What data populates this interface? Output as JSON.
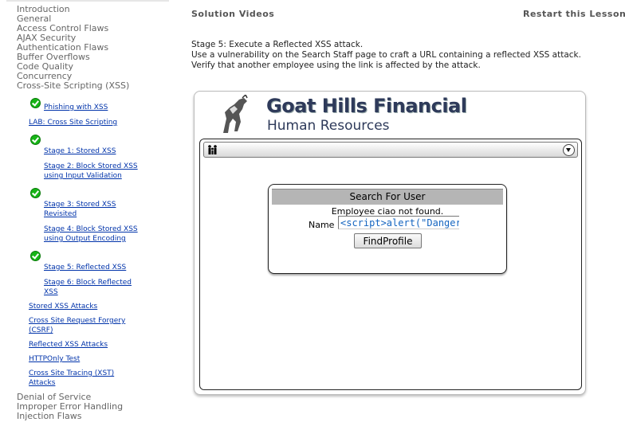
{
  "sidebar": {
    "categories_top": [
      "Introduction",
      "General",
      "Access Control Flaws",
      "AJAX Security",
      "Authentication Flaws",
      "Buffer Overflows",
      "Code Quality",
      "Concurrency",
      "Cross-Site Scripting (XSS)"
    ],
    "lessons": {
      "phishing": "Phishing with XSS",
      "lab": "LAB: Cross Site Scripting",
      "stage1": "Stage 1: Stored XSS",
      "stage2_a": "Stage 2: Block Stored XSS",
      "stage2_b": "using Input Validation",
      "stage3_a": "Stage 3: Stored XSS",
      "stage3_b": "Revisited",
      "stage4_a": "Stage 4: Block Stored XSS",
      "stage4_b": "using Output Encoding",
      "stage5": "Stage 5: Reflected XSS",
      "stage6_a": "Stage 6: Block Reflected",
      "stage6_b": "XSS",
      "stored": "Stored XSS Attacks",
      "csrf_a": "Cross Site Request Forgery",
      "csrf_b": "(CSRF)",
      "reflected": "Reflected XSS Attacks",
      "httponly": "HTTPOnly Test",
      "xst_a": "Cross Site Tracing (XST)",
      "xst_b": "Attacks"
    },
    "categories_bottom": [
      "Denial of Service",
      "Improper Error Handling",
      "Injection Flaws"
    ]
  },
  "header": {
    "solution_videos": "Solution Videos",
    "restart": "Restart this Lesson"
  },
  "lesson": {
    "line1": "Stage 5: Execute a Reflected XSS attack.",
    "line2": "Use a vulnerability on the Search Staff page to craft a URL containing a reflected XSS attack.",
    "line3": "Verify that another employee using the link is affected by the attack."
  },
  "app": {
    "title": "Goat Hills Financial",
    "subtitle": "Human Resources",
    "search": {
      "heading": "Search For User",
      "message": "Employee ciao not found.",
      "name_label": "Name",
      "name_value": "<script>alert(\"Dangerous",
      "button": "FindProfile"
    }
  }
}
